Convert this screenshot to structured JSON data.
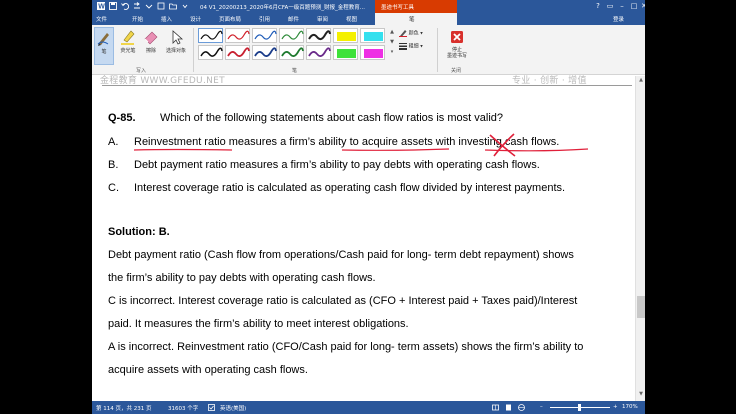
{
  "window": {
    "title": "04 V1_20200213_2020年6月CFA一级百题预测_财报_金程教育...",
    "contextual_group": "墨迹书写工具",
    "user": "登录",
    "buttons": {
      "help": "?",
      "restore": "▭",
      "minimize": "–",
      "maximize": "□",
      "close": "✕"
    }
  },
  "tabs": [
    "文件",
    "开始",
    "插入",
    "设计",
    "页面布局",
    "引用",
    "邮件",
    "审阅",
    "视图",
    "笔"
  ],
  "ribbon": {
    "write_group": {
      "label": "写入",
      "buttons": [
        {
          "label": "笔",
          "icon": "pen-icon",
          "selected": true
        },
        {
          "label": "荧光笔",
          "icon": "highlighter-icon",
          "selected": false
        },
        {
          "label": "擦除",
          "icon": "eraser-icon",
          "selected": false
        },
        {
          "label": "选择对象",
          "icon": "select-objects-icon",
          "selected": false
        }
      ]
    },
    "pens_group": {
      "label": "笔",
      "colors_label": "颜色",
      "thickness_label": "粗细"
    },
    "close_group": {
      "label": "关闭",
      "stop_label": "停止\n墨迹书写"
    }
  },
  "header": {
    "left": "金程教育 WWW.GFEDU.NET",
    "right": "专业 · 创新 · 增值"
  },
  "document": {
    "question_number": "Q-85.",
    "question_text": "Which of the following statements about cash flow ratios is most valid?",
    "options": [
      {
        "letter": "A.",
        "text": "Reinvestment ratio measures a firm’s ability to acquire assets with investing cash flows."
      },
      {
        "letter": "B.",
        "text": "Debt payment ratio measures a firm’s ability to pay debts with operating cash flows."
      },
      {
        "letter": "C.",
        "text": "Interest coverage ratio is calculated as operating cash flow divided by interest payments."
      }
    ],
    "solution_title": "Solution: B.",
    "solution_lines": [
      "Debt payment ratio (Cash flow from operations/Cash paid for long- term debt repayment) shows",
      "the firm’s ability to pay debts with operating cash flows.",
      "C is incorrect. Interest coverage ratio is calculated as (CFO + Interest paid + Taxes paid)/Interest",
      "paid. It measures the firm’s ability to meet interest obligations.",
      "A is incorrect. Reinvestment ratio (CFO/Cash paid for long- term assets) shows the firm’s ability to",
      "acquire assets with operating cash flows."
    ]
  },
  "status": {
    "page": "第 114 页，共 231 页",
    "words": "31603 个字",
    "language": "英语(美国)",
    "zoom": "170%"
  },
  "colors": {
    "title_bar": "#2b579a",
    "contextual_tab": "#d83b01",
    "ink_red": "#e0203a",
    "ribbon_bg": "#f3f3f3"
  }
}
